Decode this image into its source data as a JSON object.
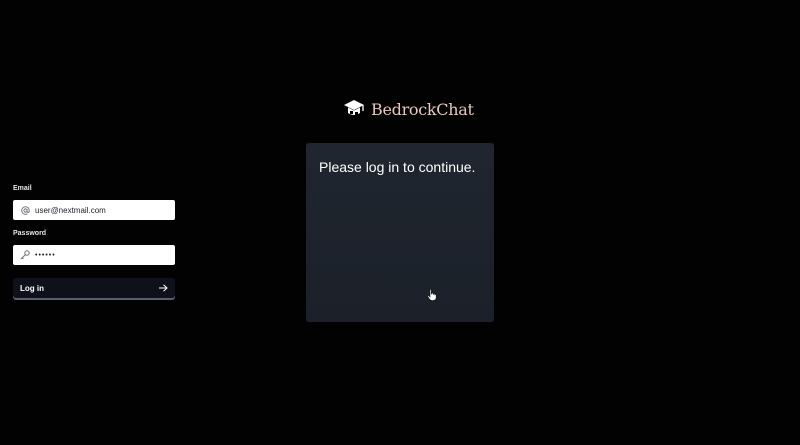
{
  "brand": {
    "name": "BedrockChat",
    "icon": "graduation-cap-icon",
    "color": "#e8c8bf"
  },
  "login_card": {
    "title": "Please log in to continue.",
    "email": {
      "label": "Email",
      "value": "user@nextmail.com",
      "icon": "at-sign-icon"
    },
    "password": {
      "label": "Password",
      "value": "••••••",
      "icon": "key-icon"
    },
    "submit": {
      "label": "Log in",
      "icon": "arrow-right-icon"
    }
  },
  "colors": {
    "background": "#020202",
    "card": "#1e242d",
    "button": "#0e1119"
  }
}
